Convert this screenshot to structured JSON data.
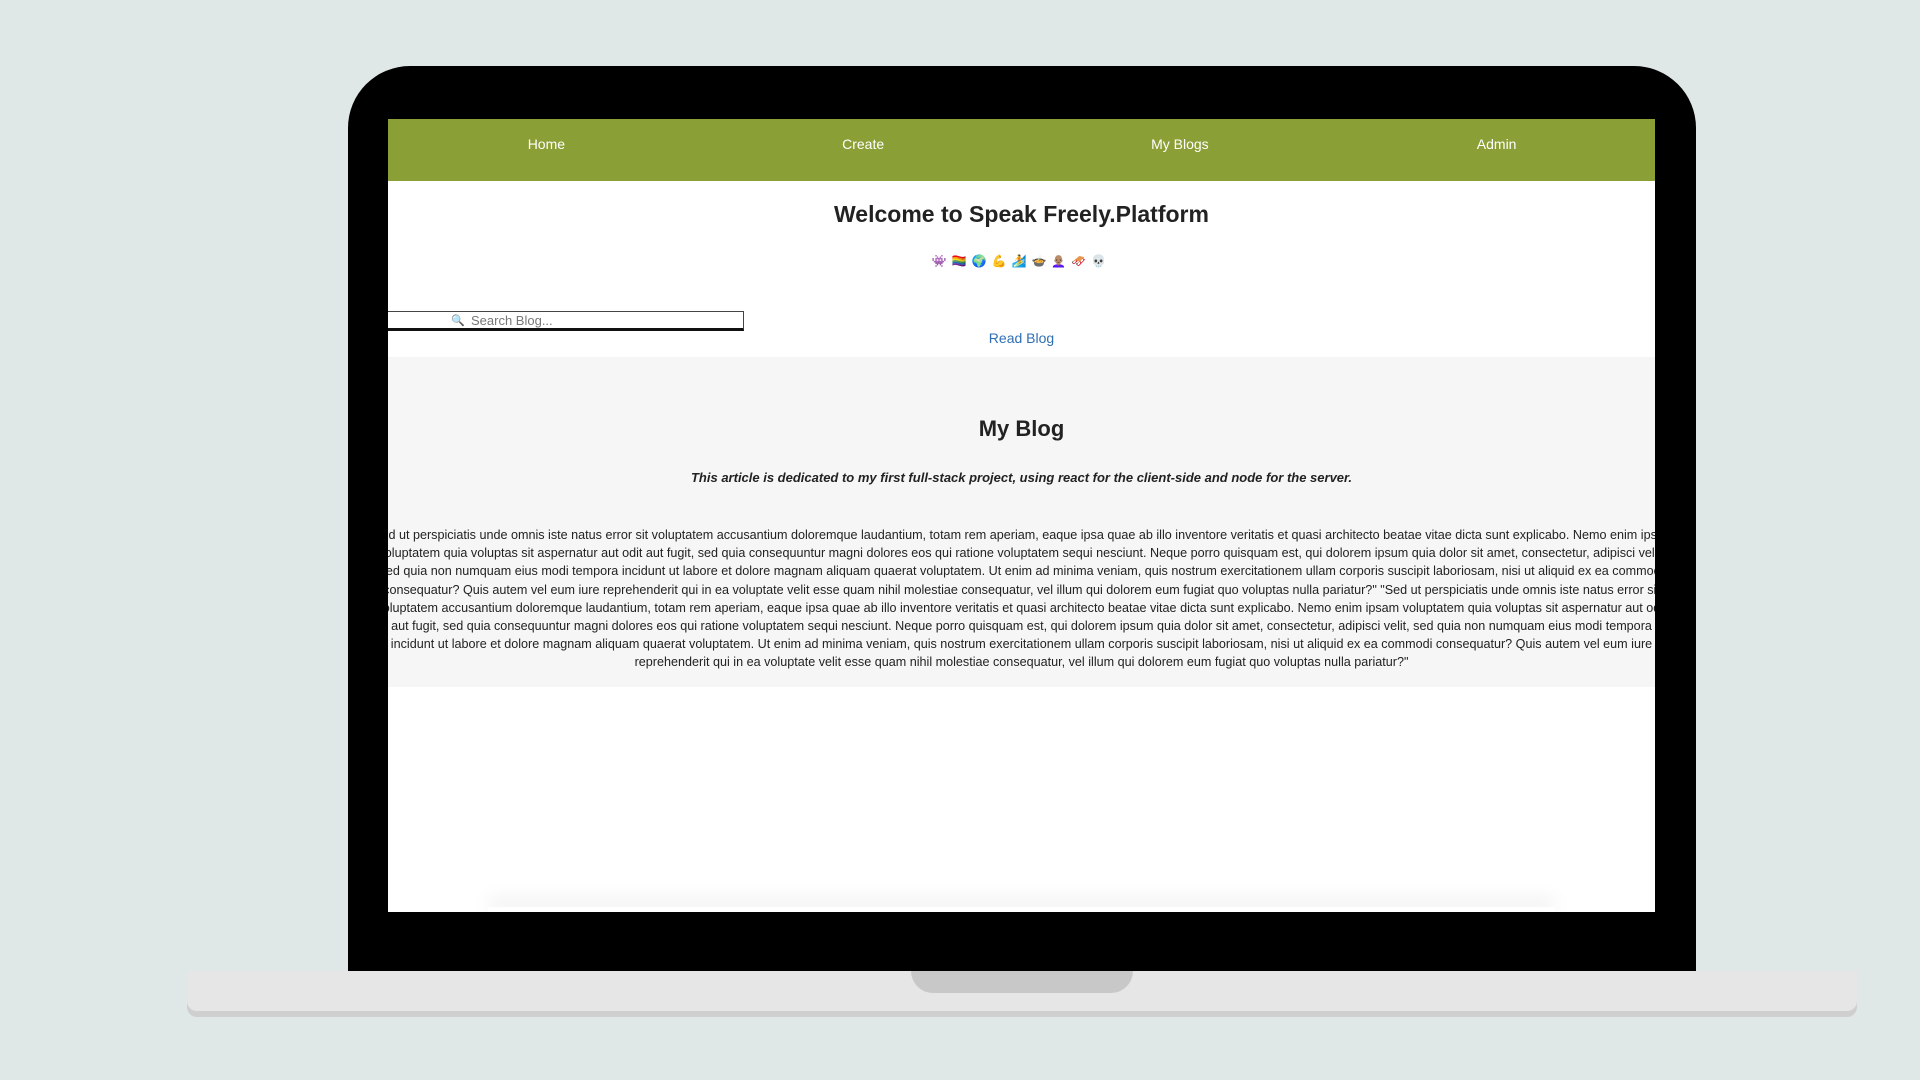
{
  "nav": {
    "items": [
      {
        "label": "Home"
      },
      {
        "label": "Create"
      },
      {
        "label": "My Blogs"
      },
      {
        "label": "Admin"
      }
    ]
  },
  "header": {
    "title": "Welcome to Speak Freely.Platform",
    "emojis": "👾🏳️‍🌈🌍💪🏄🍲👩🏽‍🦲🛷💀"
  },
  "search": {
    "icon": "🔍",
    "placeholder": "Search Blog..."
  },
  "read_link": "Read Blog",
  "article": {
    "title": "My Blog",
    "subtitle": "This article is dedicated to my first full-stack project, using react for the client-side and node for the server.",
    "body": "\"Sed ut perspiciatis unde omnis iste natus error sit voluptatem accusantium doloremque laudantium, totam rem aperiam, eaque ipsa quae ab illo inventore veritatis et quasi architecto beatae vitae dicta sunt explicabo. Nemo enim ipsam voluptatem quia voluptas sit aspernatur aut odit aut fugit, sed quia consequuntur magni dolores eos qui ratione voluptatem sequi nesciunt. Neque porro quisquam est, qui dolorem ipsum quia dolor sit amet, consectetur, adipisci velit, sed quia non numquam eius modi tempora incidunt ut labore et dolore magnam aliquam quaerat voluptatem. Ut enim ad minima veniam, quis nostrum exercitationem ullam corporis suscipit laboriosam, nisi ut aliquid ex ea commodi consequatur? Quis autem vel eum iure reprehenderit qui in ea voluptate velit esse quam nihil molestiae consequatur, vel illum qui dolorem eum fugiat quo voluptas nulla pariatur?\" \"Sed ut perspiciatis unde omnis iste natus error sit voluptatem accusantium doloremque laudantium, totam rem aperiam, eaque ipsa quae ab illo inventore veritatis et quasi architecto beatae vitae dicta sunt explicabo. Nemo enim ipsam voluptatem quia voluptas sit aspernatur aut odit aut fugit, sed quia consequuntur magni dolores eos qui ratione voluptatem sequi nesciunt. Neque porro quisquam est, qui dolorem ipsum quia dolor sit amet, consectetur, adipisci velit, sed quia non numquam eius modi tempora incidunt ut labore et dolore magnam aliquam quaerat voluptatem. Ut enim ad minima veniam, quis nostrum exercitationem ullam corporis suscipit laboriosam, nisi ut aliquid ex ea commodi consequatur? Quis autem vel eum iure reprehenderit qui in ea voluptate velit esse quam nihil molestiae consequatur, vel illum qui dolorem eum fugiat quo voluptas nulla pariatur?\""
  },
  "colors": {
    "nav_background": "#8a9f35",
    "link": "#2f6fb5",
    "article_background": "#f6f6f6",
    "page_background": "#dfe8e7"
  }
}
